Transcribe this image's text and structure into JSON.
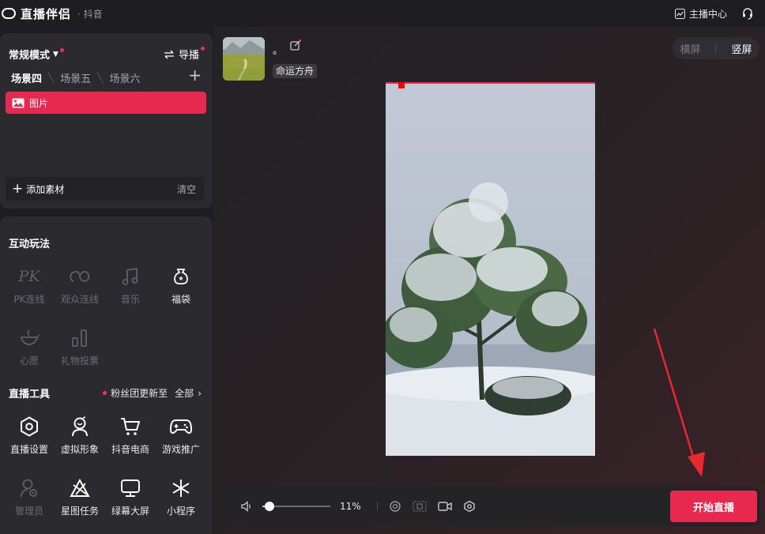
{
  "app": {
    "title": "直播伴侣",
    "subtitle": "· 抖音"
  },
  "titlebar": {
    "creator_center": "主播中心"
  },
  "scenes": {
    "mode_label": "常规模式",
    "guide_label": "导播",
    "tabs": [
      "场景四",
      "场景五",
      "场景六"
    ],
    "active_tab": 0,
    "items": [
      {
        "label": "图片",
        "icon": "image-icon"
      }
    ],
    "add_material": "添加素材",
    "clear": "清空"
  },
  "interactive": {
    "title": "互动玩法",
    "items": [
      {
        "label": "PK连线",
        "icon": "pk-icon",
        "enabled": false
      },
      {
        "label": "观众连线",
        "icon": "audience-link-icon",
        "enabled": false
      },
      {
        "label": "音乐",
        "icon": "music-icon",
        "enabled": false
      },
      {
        "label": "福袋",
        "icon": "lucky-bag-icon",
        "enabled": true
      },
      {
        "label": "心愿",
        "icon": "wish-icon",
        "enabled": false
      },
      {
        "label": "礼物投票",
        "icon": "gift-vote-icon",
        "enabled": false
      }
    ]
  },
  "live_tools": {
    "title": "直播工具",
    "notice": "粉丝团更新至",
    "all_label": "全部",
    "items": [
      {
        "label": "直播设置",
        "icon": "settings-hexagon-icon",
        "enabled": true
      },
      {
        "label": "虚拟形象",
        "icon": "avatar-figure-icon",
        "enabled": true
      },
      {
        "label": "抖音电商",
        "icon": "cart-icon",
        "enabled": true
      },
      {
        "label": "游戏推广",
        "icon": "gamepad-icon",
        "enabled": true
      },
      {
        "label": "管理员",
        "icon": "admin-icon",
        "enabled": false
      },
      {
        "label": "星图任务",
        "icon": "star-map-icon",
        "enabled": true
      },
      {
        "label": "绿幕大屏",
        "icon": "monitor-icon",
        "enabled": true
      },
      {
        "label": "小程序",
        "icon": "mini-program-icon",
        "enabled": true
      }
    ]
  },
  "stream": {
    "title": "。",
    "tag": "命运方舟",
    "orientation": {
      "options": [
        "横屏",
        "竖屏"
      ],
      "selected": 1
    }
  },
  "controls": {
    "volume_percent": 11,
    "volume_label": "11%",
    "start_button": "开始直播"
  },
  "colors": {
    "accent": "#e8294f",
    "panel": "#2b2b2f",
    "background": "#1e1e22"
  }
}
